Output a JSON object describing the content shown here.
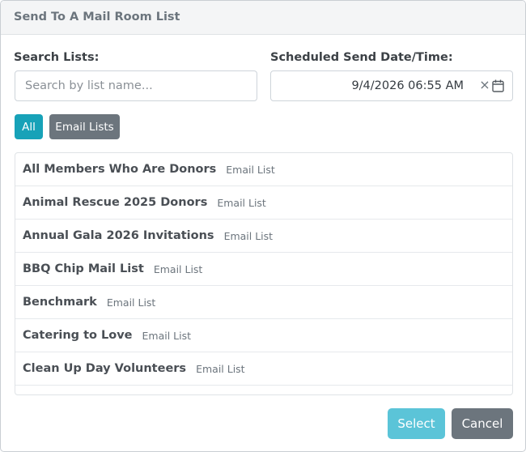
{
  "dialog": {
    "title": "Send To A Mail Room List"
  },
  "search": {
    "label": "Search Lists:",
    "placeholder": "Search by list name...",
    "value": ""
  },
  "schedule": {
    "label": "Scheduled Send Date/Time:",
    "value": "9/4/2026 06:55 AM",
    "clear_glyph": "×",
    "calendar_icon": "calendar-icon"
  },
  "filters": [
    {
      "label": "All",
      "active": true,
      "color": "#17a2b8"
    },
    {
      "label": "Email Lists",
      "active": false,
      "color": "#6c757d"
    }
  ],
  "lists": [
    {
      "name": "All Members Who Are Donors",
      "type": "Email List"
    },
    {
      "name": "Animal Rescue 2025 Donors",
      "type": "Email List"
    },
    {
      "name": "Annual Gala 2026 Invitations",
      "type": "Email List"
    },
    {
      "name": "BBQ Chip Mail List",
      "type": "Email List"
    },
    {
      "name": "Benchmark",
      "type": "Email List"
    },
    {
      "name": "Catering to Love",
      "type": "Email List"
    },
    {
      "name": "Clean Up Day Volunteers",
      "type": "Email List"
    }
  ],
  "footer": {
    "select_label": "Select",
    "select_color": "#5bc4d8",
    "cancel_label": "Cancel",
    "cancel_color": "#6c757d"
  }
}
